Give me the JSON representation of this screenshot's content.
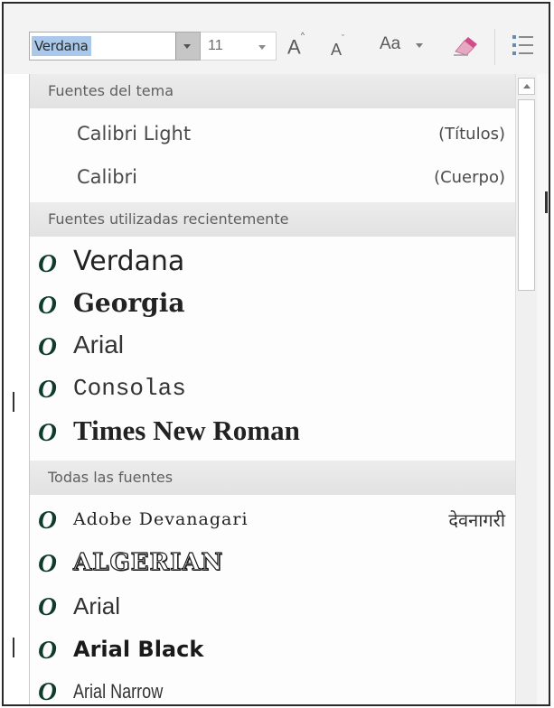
{
  "toolbar": {
    "font_name": "Verdana",
    "font_size": "11",
    "grow_font_icon": "A",
    "shrink_font_icon": "A",
    "change_case_label": "Aa",
    "clear_formatting_icon": "eraser-icon",
    "list_icon": "bullets-icon"
  },
  "theme_fonts": {
    "header": "Fuentes del tema",
    "items": [
      {
        "name": "Calibri Light",
        "role": "(Títulos)"
      },
      {
        "name": "Calibri",
        "role": "(Cuerpo)"
      }
    ]
  },
  "recent_fonts": {
    "header": "Fuentes utilizadas recientemente",
    "items": [
      {
        "name": "Verdana"
      },
      {
        "name": "Georgia"
      },
      {
        "name": "Arial"
      },
      {
        "name": "Consolas"
      },
      {
        "name": "Times New Roman"
      }
    ]
  },
  "all_fonts": {
    "header": "Todas las fuentes",
    "items": [
      {
        "name": "Adobe Devanagari",
        "sample": "देवनागरी"
      },
      {
        "name": "ALGERIAN"
      },
      {
        "name": "Arial"
      },
      {
        "name": "Arial Black"
      },
      {
        "name": "Arial Narrow"
      }
    ]
  },
  "font_type_glyph": "O",
  "colors": {
    "selection": "#a9c8ea",
    "section_header_bg": "#e6e6e6",
    "opentype_glyph": "#0f3b2e"
  }
}
